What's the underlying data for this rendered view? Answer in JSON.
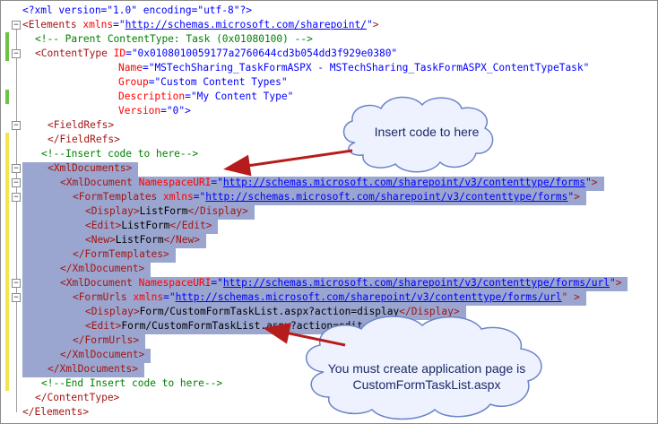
{
  "editor": {
    "xml_decl": "<?xml version=\"1.0\" encoding=\"utf-8\"?>",
    "elements_open_tag": "<Elements",
    "xmlns_attr": "xmlns",
    "xmlns_value": "http://schemas.microsoft.com/sharepoint/",
    "comment_parent": "<!-- Parent ContentType: Task (0x01080100) -->",
    "contenttype_tag": "<ContentType",
    "id_attr": "ID",
    "id_value": "\"0x0108010059177a2760644cd3b054dd3f929e0380\"",
    "name_attr": "Name",
    "name_value": "\"MSTechSharing_TaskFormASPX - MSTechSharing_TaskFormASPX_ContentTypeTask\"",
    "group_attr": "Group",
    "group_value": "\"Custom Content Types\"",
    "desc_attr": "Description",
    "desc_value": "\"My Content Type\"",
    "version_attr": "Version",
    "version_value": "\"0\">",
    "fieldrefs_open": "<FieldRefs>",
    "fieldrefs_close": "</FieldRefs>",
    "comment_insert": "<!--Insert code to here-->",
    "xmldocuments_open": "<XmlDocuments>",
    "xmldocument_tag": "<XmlDocument",
    "namespaceuri_attr": "NamespaceURI",
    "ns_forms": "http://schemas.microsoft.com/sharepoint/v3/contenttype/forms",
    "formtemplates_tag": "<FormTemplates",
    "display_open": "<Display>",
    "display_close": "</Display>",
    "listform_text": "ListForm",
    "edit_open": "<Edit>",
    "edit_close": "</Edit>",
    "new_open": "<New>",
    "new_close": "</New>",
    "formtemplates_close": "</FormTemplates>",
    "xmldocument_close": "</XmlDocument>",
    "ns_forms_url": "http://schemas.microsoft.com/sharepoint/v3/contenttype/forms/url",
    "formurls_tag": "<FormUrls",
    "display_url_text": "Form/CustomFormTaskList.aspx?action=display",
    "edit_url_text": "Form/CustomFormTaskList.aspx?action=edit",
    "formurls_close": "</FormUrls>",
    "xmldocuments_close": "</XmlDocuments>",
    "comment_end": "<!--End Insert code to here-->",
    "contenttype_close": "</ContentType>",
    "elements_close": "</Elements>",
    "quote": "\"",
    "gt": ">",
    "gt_sp": "\" >",
    "eq": "="
  },
  "callouts": {
    "insert_here": "Insert code to here",
    "app_page_line1": "You must create application page is",
    "app_page_line2": "CustomFormTaskList.aspx"
  },
  "colors": {
    "tag": "#a31515",
    "attr": "#ff0000",
    "value": "#0000ff",
    "comment": "#008000",
    "selection": "#9aa6cf",
    "callout_fill": "#eef2ff",
    "callout_border": "#6b84c8",
    "arrow": "#b71c1c"
  }
}
